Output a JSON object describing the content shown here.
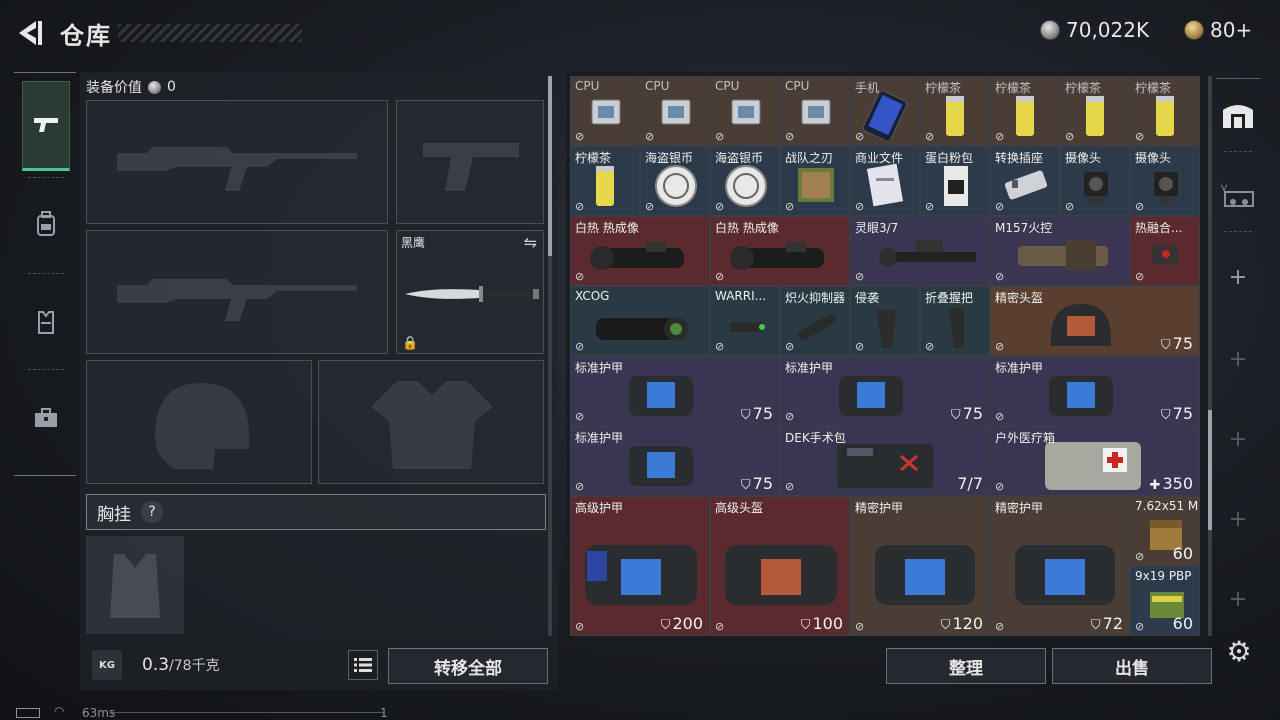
{
  "header": {
    "title": "仓库",
    "currency_coin": "70,022K",
    "currency_gold": "80+"
  },
  "rail": {
    "tabs": [
      "pistol-icon",
      "backpack-icon",
      "vest-icon",
      "toolbox-icon"
    ]
  },
  "equipment": {
    "value_label": "装备价值",
    "value": "0",
    "melee_label": "黑鹰",
    "chest_rig_label": "胸挂",
    "help": "?"
  },
  "bottom_left": {
    "kg_label": "KG",
    "weight": "0.3",
    "weight_max": "/78千克",
    "transfer_label": "转移全部"
  },
  "inventory": {
    "cells": [
      {
        "label": "CPU",
        "dim": true
      },
      {
        "label": "CPU",
        "dim": true
      },
      {
        "label": "CPU",
        "dim": true
      },
      {
        "label": "CPU",
        "dim": true
      },
      {
        "label": "手机",
        "dim": true
      },
      {
        "label": "柠檬茶",
        "dim": true
      },
      {
        "label": "柠檬茶",
        "dim": true
      },
      {
        "label": "柠檬茶",
        "dim": true
      },
      {
        "label": "柠檬茶",
        "dim": true
      },
      {
        "label": "柠檬茶"
      },
      {
        "label": "海盗银币"
      },
      {
        "label": "海盗银币"
      },
      {
        "label": "战队之刃"
      },
      {
        "label": "商业文件"
      },
      {
        "label": "蛋白粉包"
      },
      {
        "label": "转换插座"
      },
      {
        "label": "摄像头"
      },
      {
        "label": "摄像头"
      },
      {
        "label": "白热 热成像"
      },
      {
        "label": "白热 热成像"
      },
      {
        "label": "灵眼3/7"
      },
      {
        "label": "M157火控"
      },
      {
        "label": "热融合..."
      },
      {
        "label": "XCOG"
      },
      {
        "label": "WARRI..."
      },
      {
        "label": "炽火抑制器"
      },
      {
        "label": "侵袭"
      },
      {
        "label": "折叠握把"
      },
      {
        "label": "精密头盔",
        "value": "75"
      },
      {
        "label": "标准护甲",
        "value": "75"
      },
      {
        "label": "标准护甲",
        "value": "75"
      },
      {
        "label": "标准护甲",
        "value": "75"
      },
      {
        "label": "标准护甲",
        "value": "75"
      },
      {
        "label": "DEK手术包",
        "value": "7/7"
      },
      {
        "label": "户外医疗箱",
        "value": "350"
      },
      {
        "label": "高级护甲",
        "value": "200"
      },
      {
        "label": "高级头盔",
        "value": "100"
      },
      {
        "label": "精密护甲",
        "value": "120"
      },
      {
        "label": "精密护甲",
        "value": "72"
      },
      {
        "label": "7.62x51 M62",
        "value": "60"
      },
      {
        "label": "9x19 PBP",
        "value": "60"
      }
    ]
  },
  "right_rail": {
    "items": [
      "vest-tab-icon",
      "vehicle-case-icon",
      "+",
      "+",
      "+",
      "+",
      "+"
    ]
  },
  "bottom_right": {
    "sort_label": "整理",
    "sell_label": "出售"
  },
  "status": {
    "ping": "63ms",
    "num": "1"
  },
  "colors": {
    "accent": "#47c79a",
    "cell_brown": "#4a3d35",
    "cell_blue": "#2c3a4a",
    "cell_red": "#5a2a2e",
    "cell_purple": "#3a3550"
  }
}
